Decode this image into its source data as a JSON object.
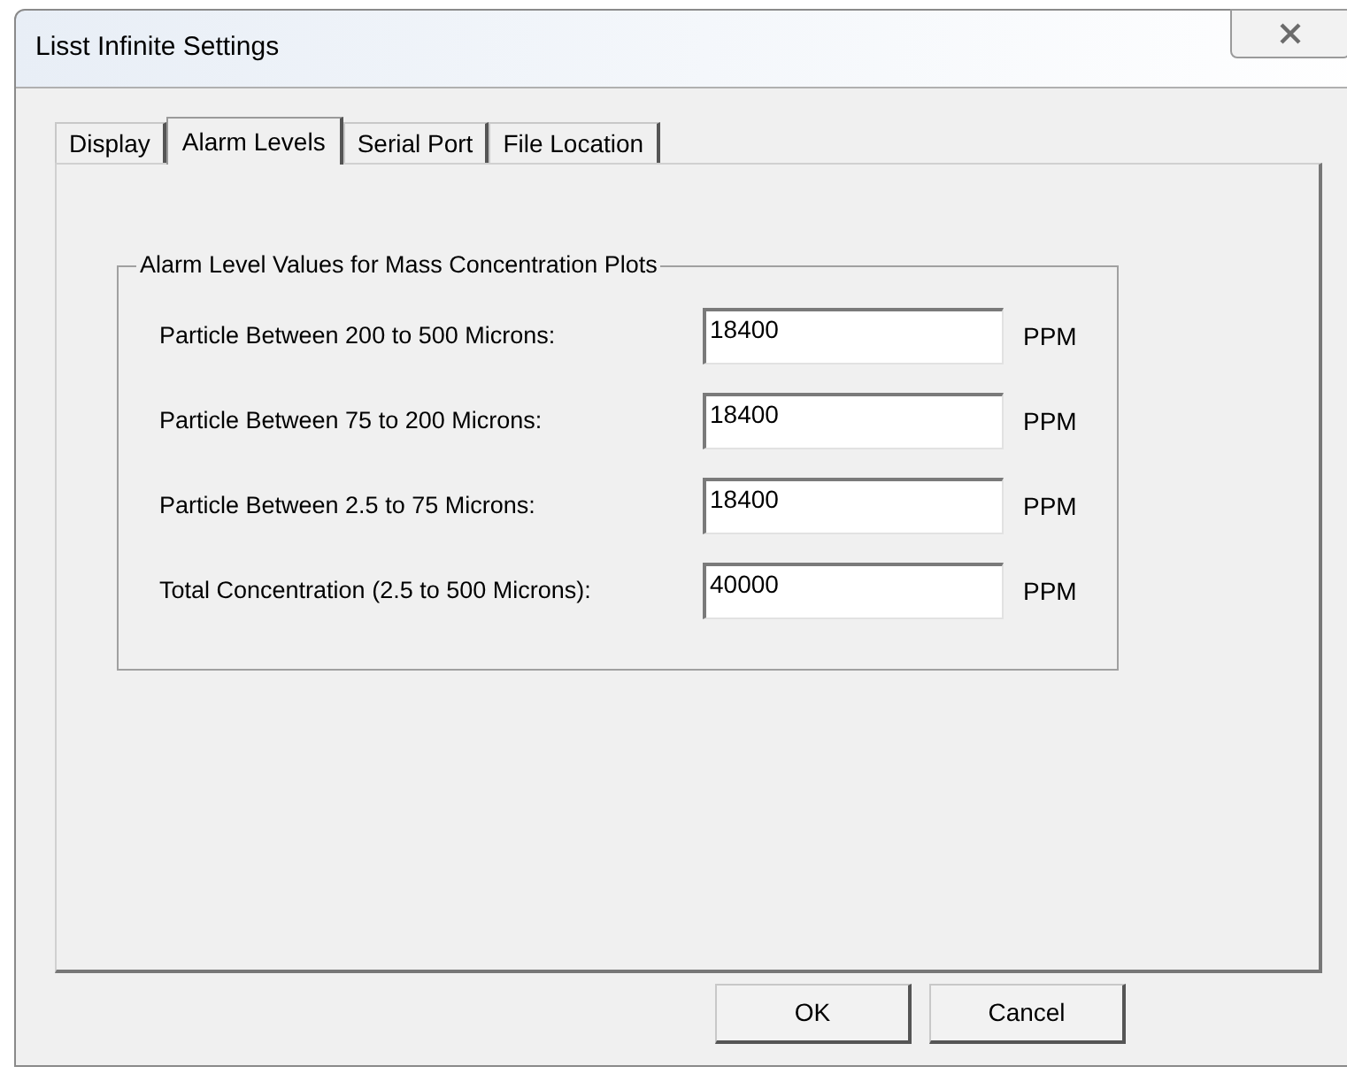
{
  "window": {
    "title": "Lisst Infinite Settings"
  },
  "tabs": [
    {
      "label": "Display",
      "selected": false
    },
    {
      "label": "Alarm Levels",
      "selected": true
    },
    {
      "label": "Serial Port",
      "selected": false
    },
    {
      "label": "File Location",
      "selected": false
    }
  ],
  "group": {
    "title": "Alarm Level Values for Mass Concentration Plots",
    "rows": [
      {
        "label": "Particle Between 200 to 500 Microns:",
        "value": "18400",
        "unit": "PPM"
      },
      {
        "label": "Particle Between 75 to 200 Microns:",
        "value": "18400",
        "unit": "PPM"
      },
      {
        "label": "Particle Between 2.5 to 75 Microns:",
        "value": "18400",
        "unit": "PPM"
      },
      {
        "label": "Total Concentration (2.5 to 500 Microns):",
        "value": "40000",
        "unit": "PPM"
      }
    ]
  },
  "buttons": [
    "OK",
    "Cancel"
  ]
}
